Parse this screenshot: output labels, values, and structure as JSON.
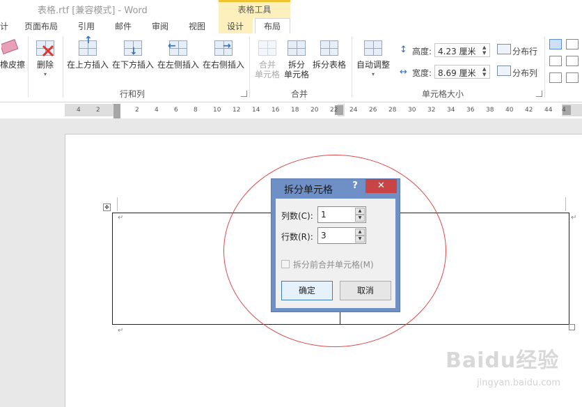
{
  "title_bar": {
    "doc_title": "表格.rtf [兼容模式] - Word",
    "context_group": "表格工具"
  },
  "tabs": [
    "计",
    "页面布局",
    "引用",
    "邮件",
    "审阅",
    "视图",
    "设计",
    "布局"
  ],
  "active_tab": "布局",
  "ribbon": {
    "eraser": "橡皮擦",
    "delete": "删除",
    "insert_above": "在上方插入",
    "insert_below": "在下方插入",
    "insert_left": "在左侧插入",
    "insert_right": "在右侧插入",
    "group_rows_cols": "行和列",
    "merge_cells_1": "合并",
    "merge_cells_2": "单元格",
    "split_cells_1": "拆分",
    "split_cells_2": "单元格",
    "split_table": "拆分表格",
    "group_merge": "合并",
    "autofit": "自动调整",
    "height_label": "高度:",
    "height_value": "4.23 厘米",
    "width_label": "宽度:",
    "width_value": "8.69 厘米",
    "distribute_rows": "分布行",
    "distribute_cols": "分布列",
    "group_cell_size": "单元格大小"
  },
  "ruler_ticks": [
    "4",
    "2",
    "2",
    "4",
    "6",
    "8",
    "10",
    "12",
    "14",
    "16",
    "18",
    "20",
    "22",
    "24",
    "26",
    "28",
    "30",
    "32",
    "34",
    "36",
    "38",
    "40",
    "42",
    "44",
    "4"
  ],
  "dialog": {
    "title": "拆分单元格",
    "help": "?",
    "close": "✕",
    "columns_label": "列数(C):",
    "columns_value": "1",
    "rows_label": "行数(R):",
    "rows_value": "3",
    "merge_before_split": "拆分前合并单元格(M)",
    "ok": "确定",
    "cancel": "取消"
  },
  "watermark": {
    "logo": "Baidu经验",
    "url": "jingyan.baidu.com"
  },
  "colors": {
    "context_tab": "#fdf0bd",
    "dialog_frame": "#6f8fc7",
    "close_button": "#c94545",
    "annotation_ellipse": "#e04848"
  }
}
